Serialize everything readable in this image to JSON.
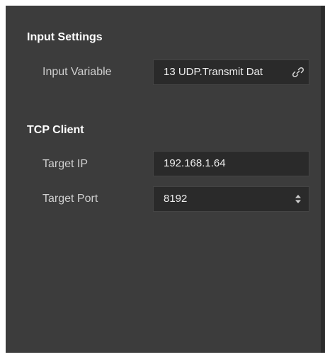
{
  "sections": [
    {
      "title": "Input Settings",
      "fields": [
        {
          "label": "Input Variable",
          "value": "13 UDP.Transmit Dat",
          "icon": "link-icon"
        }
      ]
    },
    {
      "title": "TCP Client",
      "fields": [
        {
          "label": "Target IP",
          "value": "192.168.1.64"
        },
        {
          "label": "Target Port",
          "value": "8192",
          "icon": "spinner-icon"
        }
      ]
    }
  ],
  "colors": {
    "panel_bg": "#3c3c3c",
    "field_bg": "#2a2a2a",
    "text": "#e6e6e6"
  }
}
